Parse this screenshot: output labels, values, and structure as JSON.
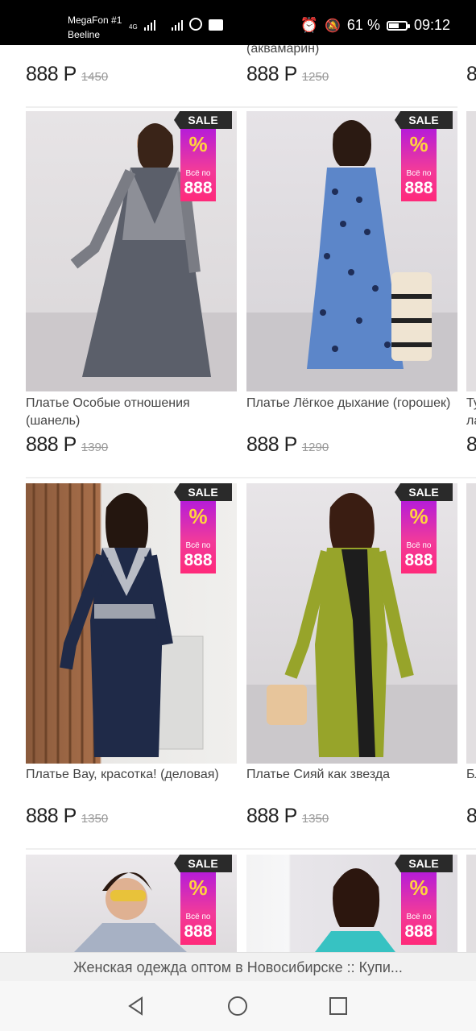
{
  "status_bar": {
    "carrier1": "MegaFon #1",
    "carrier2": "Beeline",
    "network": "4G",
    "battery": "61 %",
    "battery_level": 0.61,
    "time": "09:12"
  },
  "top_row": {
    "partial_name": "(аквамарин)",
    "items": [
      {
        "price": "888 Р",
        "old_price": "1450"
      },
      {
        "price": "888 Р",
        "old_price": "1250"
      },
      {
        "price": "8"
      }
    ]
  },
  "badge": {
    "sale": "SALE",
    "percent": "%",
    "all_for": "Всё по",
    "value": "888"
  },
  "rows": [
    {
      "products": [
        {
          "name": "Платье Особые отношения (шанель)",
          "price": "888 Р",
          "old_price": "1390",
          "image": "dress-houndstooth"
        },
        {
          "name": "Платье Лёгкое дыхание (горошек)",
          "price": "888 Р",
          "old_price": "1290",
          "image": "dress-polka-dot"
        }
      ],
      "partial_name": "Ту\nла",
      "partial_price": "8"
    },
    {
      "products": [
        {
          "name": "Платье Вау, красотка! (деловая)",
          "price": "888 Р",
          "old_price": "1350",
          "image": "dress-navy-business"
        },
        {
          "name": "Платье Сияй как звезда",
          "price": "888 Р",
          "old_price": "1350",
          "image": "dress-olive-lace"
        }
      ],
      "partial_name": "Бл",
      "partial_price": "8"
    }
  ],
  "page_title_bar": "Женская одежда оптом в Новосибирске :: Купи...",
  "nav": {
    "back": "back-triangle-icon",
    "home": "home-circle-icon",
    "recents": "recents-square-icon"
  },
  "colors": {
    "badge_gradient_top": "#b61cd8",
    "badge_gradient_bottom": "#ff2a7a",
    "badge_percent": "#ffd23f",
    "sale_tag": "#2a2a2a"
  }
}
